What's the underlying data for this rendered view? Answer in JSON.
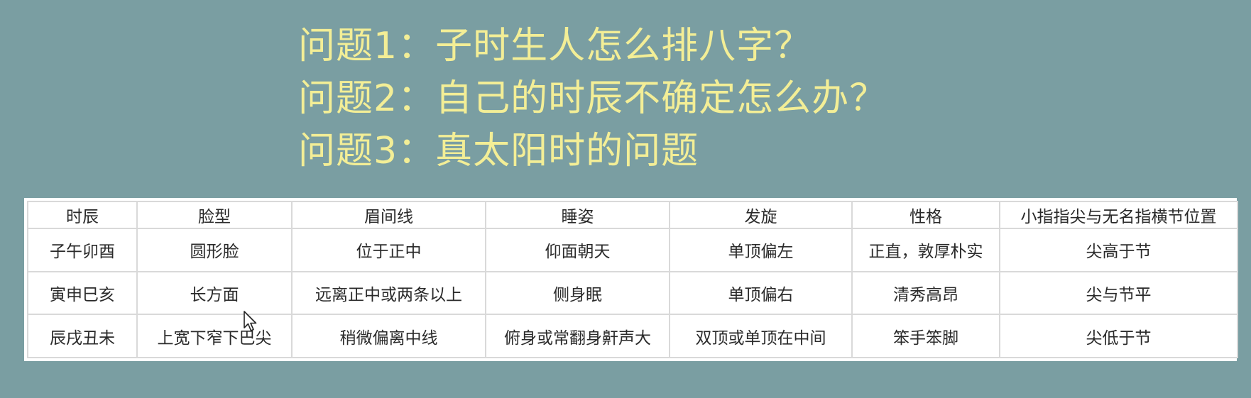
{
  "questions": [
    "问题1：子时生人怎么排八字？",
    "问题2：自己的时辰不确定怎么办？",
    "问题3：真太阳时的问题"
  ],
  "table": {
    "headers": [
      "时辰",
      "脸型",
      "眉间线",
      "睡姿",
      "发旋",
      "性格",
      "小指指尖与无名指横节位置"
    ],
    "rows": [
      [
        "子午卯酉",
        "圆形脸",
        "位于正中",
        "仰面朝天",
        "单顶偏左",
        "正直，敦厚朴实",
        "尖高于节"
      ],
      [
        "寅申巳亥",
        "长方面",
        "远离正中或两条以上",
        "侧身眠",
        "单顶偏右",
        "清秀高昂",
        "尖与节平"
      ],
      [
        "辰戌丑未",
        "上宽下窄下巴尖",
        "稍微偏离中线",
        "俯身或常翻身鼾声大",
        "双顶或单顶在中间",
        "笨手笨脚",
        "尖低于节"
      ]
    ]
  },
  "colors": {
    "background": "#7a9ea2",
    "question_text": "#f3ee96",
    "table_bg": "#ffffff",
    "grid": "#d9d9d9"
  },
  "icons": {
    "cursor": "mouse-pointer-icon"
  }
}
